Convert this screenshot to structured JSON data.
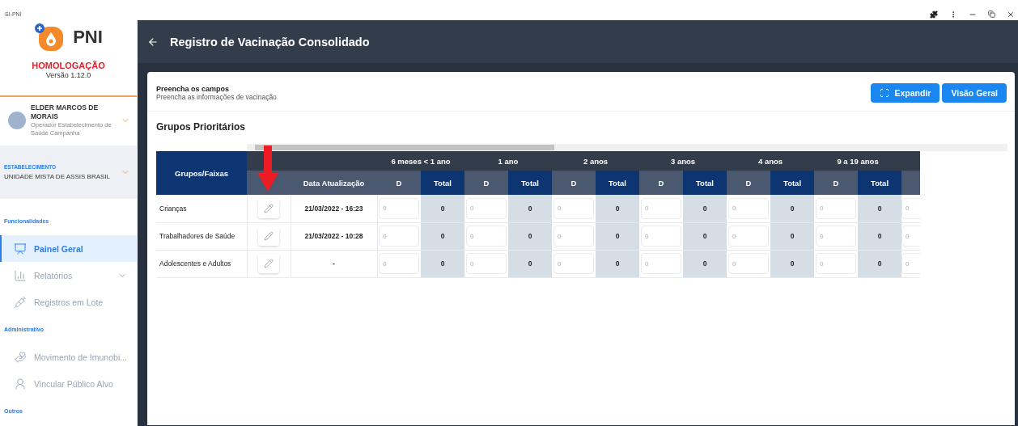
{
  "window": {
    "title": "SI-PNI"
  },
  "sidebar": {
    "brand": "PNI",
    "environment": "HOMOLOGAÇÃO",
    "version": "Versão 1.12.0",
    "user": {
      "name": "ELDER MARCOS DE MORAIS",
      "role": "Operador Estabelecimento de Saúde Campanha"
    },
    "establishment": {
      "label": "ESTABELECIMENTO",
      "value": "UNIDADE MISTA DE ASSIS BRASIL"
    },
    "sections": [
      {
        "title": "Funcionalidades",
        "items": [
          {
            "label": "Painel Geral",
            "selected": true,
            "expandable": false
          },
          {
            "label": "Relatórios",
            "selected": false,
            "expandable": true
          },
          {
            "label": "Registros em Lote",
            "selected": false,
            "expandable": false
          }
        ]
      },
      {
        "title": "Administrativo",
        "items": [
          {
            "label": "Movimento de Imunobi...",
            "selected": false,
            "expandable": false
          },
          {
            "label": "Vincular Público Alvo",
            "selected": false,
            "expandable": false
          }
        ]
      },
      {
        "title": "Outros"
      }
    ]
  },
  "header": {
    "title": "Registro de Vacinação Consolidado"
  },
  "card": {
    "title": "Preencha os campos",
    "subtitle": "Preencha as informações de vacinação",
    "buttons": [
      {
        "label": "Expandir",
        "kind": "expand"
      },
      {
        "label": "Visão Geral",
        "kind": "plain"
      }
    ],
    "section_title": "Grupos Prioritários",
    "table": {
      "group_column": "Grupos/Faixas",
      "date_column": "Data Atualização",
      "age_groups": [
        {
          "label": "6 meses < 1 ano",
          "d": "D",
          "total": "Total"
        },
        {
          "label": "1 ano",
          "d": "D",
          "total": "Total"
        },
        {
          "label": "2 anos",
          "d": "D",
          "total": "Total"
        },
        {
          "label": "3 anos",
          "d": "D",
          "total": "Total"
        },
        {
          "label": "4 anos",
          "d": "D",
          "total": "Total"
        },
        {
          "label": "9 a 19 anos",
          "d": "D",
          "total": "Total"
        }
      ],
      "rows": [
        {
          "group": "Crianças",
          "updated": "21/03/2022 - 16:23",
          "cells": [
            {
              "placeholder": "0",
              "total": "0"
            },
            {
              "placeholder": "0",
              "total": "0"
            },
            {
              "placeholder": "0",
              "total": "0"
            },
            {
              "placeholder": "0",
              "total": "0"
            },
            {
              "placeholder": "0",
              "total": "0"
            },
            {
              "placeholder": "0",
              "total": "0"
            }
          ],
          "extra_placeholder": "0"
        },
        {
          "group": "Trabalhadores de Saúde",
          "updated": "21/03/2022 - 10:28",
          "cells": [
            {
              "placeholder": "0",
              "total": "0"
            },
            {
              "placeholder": "0",
              "total": "0"
            },
            {
              "placeholder": "0",
              "total": "0"
            },
            {
              "placeholder": "0",
              "total": "0"
            },
            {
              "placeholder": "0",
              "total": "0"
            },
            {
              "placeholder": "0",
              "total": "0"
            }
          ],
          "extra_placeholder": "0"
        },
        {
          "group": "Adolescentes e Adultos",
          "updated": "-",
          "cells": [
            {
              "placeholder": "0",
              "total": "0"
            },
            {
              "placeholder": "0",
              "total": "0"
            },
            {
              "placeholder": "0",
              "total": "0"
            },
            {
              "placeholder": "0",
              "total": "0"
            },
            {
              "placeholder": "0",
              "total": "0"
            },
            {
              "placeholder": "0",
              "total": "0"
            }
          ],
          "extra_placeholder": "0"
        }
      ]
    }
  }
}
